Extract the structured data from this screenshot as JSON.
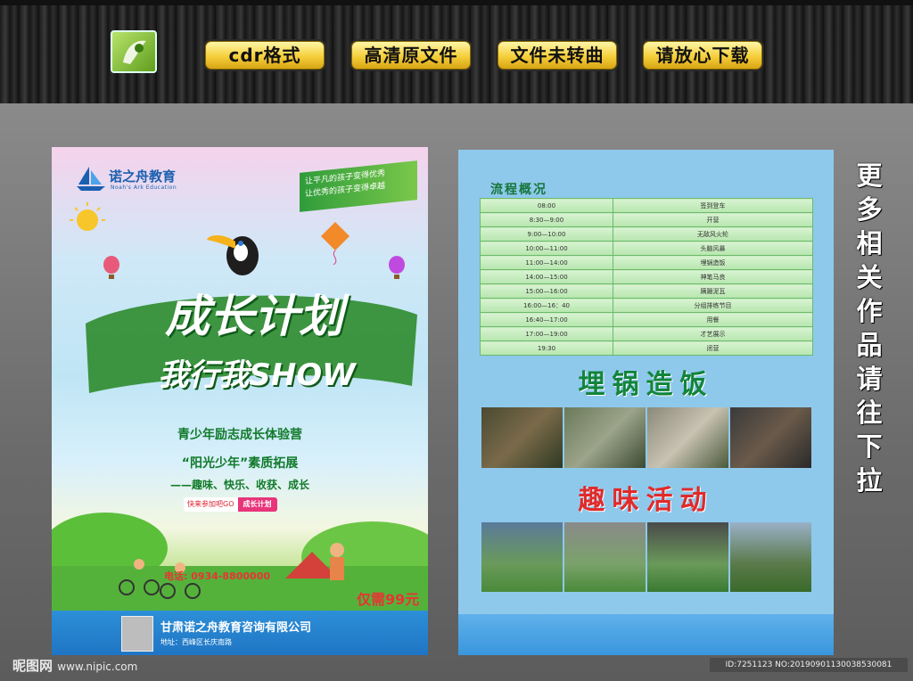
{
  "header": {
    "pills": [
      "cdr格式",
      "高清原文件",
      "文件未转曲",
      "请放心下载"
    ],
    "logo_icon": "nipic-logo-icon"
  },
  "side_text": "更\n多\n相\n关\n作\n品\n请\n往\n下\n拉",
  "flyer1": {
    "brand": "诺之舟教育",
    "brand_sub": "Noah's Ark Education",
    "slogan_line1": "让平凡的孩子变得优秀",
    "slogan_line2": "让优秀的孩子变得卓越",
    "title_line1": "成长计划",
    "title_line2": "我行我SHOW",
    "sub1": "青少年励志成长体验营",
    "sub2": "“阳光少年”素质拓展",
    "sub3": "——趣味、快乐、收获、成长",
    "go_left": "快来参加吧GO",
    "go_right": "成长计划",
    "phone": "电话: 0934-8800000",
    "price": "仅需99元",
    "company": "甘肃诺之舟教育咨询有限公司",
    "address": "地址：西峰区长庆南路"
  },
  "flyer2": {
    "flow_title": "流程概况",
    "schedule": [
      {
        "time": "08:00",
        "item": "签到登车"
      },
      {
        "time": "8:30—9:00",
        "item": "开营"
      },
      {
        "time": "9:00—10:00",
        "item": "无敌风火轮"
      },
      {
        "time": "10:00—11:00",
        "item": "头脑风暴"
      },
      {
        "time": "11:00—14:00",
        "item": "埋锅造饭"
      },
      {
        "time": "14:00—15:00",
        "item": "神笔马良"
      },
      {
        "time": "15:00—16:00",
        "item": "蹒跚泥瓦"
      },
      {
        "time": "16:00—16：40",
        "item": "分组排练节目"
      },
      {
        "time": "16:40—17:00",
        "item": "用餐"
      },
      {
        "time": "17:00—19:00",
        "item": "才艺展示"
      },
      {
        "time": "19:30",
        "item": "闭营"
      }
    ],
    "section1": "埋锅造饭",
    "section2": "趣味活动"
  },
  "watermark": {
    "site_cn": "昵图网",
    "site_url": "www.nipic.com",
    "id": "ID:7251123 NO:20190901130038530081"
  },
  "colors": {
    "pill": "#f5cf3a",
    "green": "#12843b",
    "red": "#e02b2b",
    "blue": "#8ec9ec"
  }
}
